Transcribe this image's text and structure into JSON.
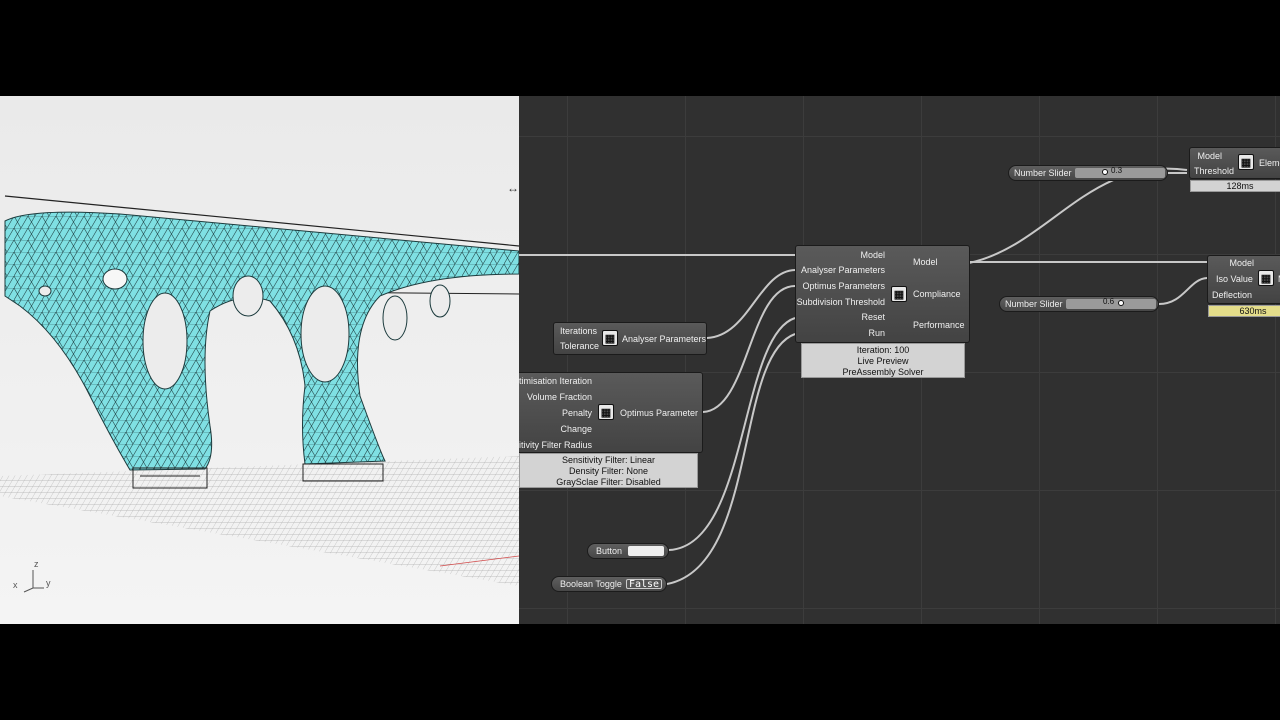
{
  "viewport": {
    "axes": {
      "z": "z",
      "x": "x",
      "y": "y"
    },
    "mesh_color": "#7fe0e3",
    "cursor_icon": "resize-horizontal-icon"
  },
  "canvas": {
    "slider_threshold": {
      "label": "Number Slider",
      "value": "0.3",
      "fill": 0.3
    },
    "slider_iso": {
      "label": "Number Slider",
      "value": "0.6",
      "fill": 0.6
    },
    "element_comp": {
      "inputs": [
        "Model",
        "Threshold"
      ],
      "output": "Eleme",
      "time": "128ms"
    },
    "iso_comp": {
      "inputs": [
        "Model",
        "Iso Value",
        "Deflection"
      ],
      "output": "M",
      "time": "630ms"
    },
    "solver": {
      "inputs": [
        "Model",
        "Analyser Parameters",
        "Optimus Parameters",
        "Subdivision Threshold",
        "Reset",
        "Run"
      ],
      "outputs": [
        "Model",
        "Compliance",
        "Performance"
      ],
      "messages": [
        "Iteration: 100",
        "Live Preview",
        "PreAssembly Solver"
      ]
    },
    "analyser": {
      "inputs": [
        "Iterations",
        "Tolerance"
      ],
      "output": "Analyser Parameters"
    },
    "optimus": {
      "inputs": [
        "ptimisation Iteration",
        "Volume Fraction",
        "Penalty",
        "Change",
        "sitivity Filter Radius"
      ],
      "output": "Optimus Parameter",
      "messages": [
        "Sensitivity Filter: Linear",
        "Density Filter: None",
        "GraySclae Filter: Disabled"
      ]
    },
    "button": {
      "label": "Button"
    },
    "toggle": {
      "label": "Boolean Toggle",
      "value": "False"
    }
  }
}
